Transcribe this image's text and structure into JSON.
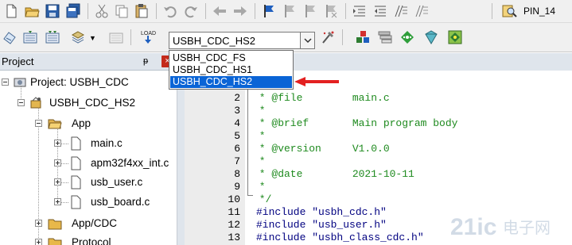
{
  "toolbar": {
    "pin_label": "PIN_14",
    "target": {
      "selected": "USBH_CDC_HS2",
      "options": [
        "USBH_CDC_FS",
        "USBH_CDC_HS1",
        "USBH_CDC_HS2"
      ],
      "highlighted_option": "USBH_CDC_HS2"
    },
    "row1_icons": [
      "new-file-icon",
      "open-folder-icon",
      "save-icon",
      "save-all-icon",
      "cut-icon",
      "copy-icon",
      "paste-icon",
      "undo-icon",
      "redo-icon",
      "nav-back-icon",
      "nav-forward-icon",
      "bookmark-icon",
      "prev-bookmark-icon",
      "next-bookmark-icon",
      "clear-bookmarks-icon",
      "indent-icon",
      "unindent-icon",
      "comment-icon",
      "uncomment-icon",
      "find-in-files-icon"
    ],
    "row2_icons": [
      "translate-icon",
      "build-icon",
      "rebuild-icon",
      "batch-build-icon",
      "stop-build-icon",
      "download-icon",
      "options-for-target-icon",
      "manage-components-icon",
      "file-extensions-icon",
      "select-packs-icon",
      "pack-installer-icon",
      "manage-runtime-icon"
    ]
  },
  "project_panel": {
    "title": "Project",
    "pin_glyph": "ᵽ",
    "close_glyph": "×",
    "tree": [
      {
        "label": "Project: USBH_CDC",
        "icon": "project-icon",
        "expander": "minus"
      },
      {
        "label": "USBH_CDC_HS2",
        "icon": "target-icon",
        "expander": "minus"
      },
      {
        "label": "App",
        "icon": "folder-open-icon",
        "expander": "minus"
      },
      {
        "label": "main.c",
        "icon": "file-icon",
        "expander": "plus"
      },
      {
        "label": "apm32f4xx_int.c",
        "icon": "file-icon",
        "expander": "plus"
      },
      {
        "label": "usb_user.c",
        "icon": "file-icon",
        "expander": "plus"
      },
      {
        "label": "usb_board.c",
        "icon": "file-icon",
        "expander": "plus"
      },
      {
        "label": "App/CDC",
        "icon": "folder-icon",
        "expander": "plus"
      },
      {
        "label": "Protocol",
        "icon": "folder-icon",
        "expander": "plus"
      }
    ]
  },
  "editor": {
    "lines": [
      {
        "num": "2",
        "text": " * @file        main.c",
        "kind": "comment"
      },
      {
        "num": "3",
        "text": " *",
        "kind": "comment"
      },
      {
        "num": "4",
        "text": " * @brief       Main program body",
        "kind": "comment"
      },
      {
        "num": "5",
        "text": " *",
        "kind": "comment"
      },
      {
        "num": "6",
        "text": " * @version     V1.0.0",
        "kind": "comment"
      },
      {
        "num": "7",
        "text": " *",
        "kind": "comment"
      },
      {
        "num": "8",
        "text": " * @date        2021-10-11",
        "kind": "comment"
      },
      {
        "num": "9",
        "text": " *",
        "kind": "comment"
      },
      {
        "num": "10",
        "text": " */",
        "kind": "comment"
      },
      {
        "num": "11",
        "text": "#include \"usbh_cdc.h\"",
        "kind": "include"
      },
      {
        "num": "12",
        "text": "#include \"usb_user.h\"",
        "kind": "include"
      },
      {
        "num": "13",
        "text": "#include \"usbh_class_cdc.h\"",
        "kind": "include"
      }
    ]
  },
  "watermark": {
    "text": "21ic 电子网",
    "color": "#9db3c9"
  },
  "colors": {
    "comment": "#1e8a1e",
    "selection": "#0a64d6",
    "arrow": "#e32020"
  }
}
